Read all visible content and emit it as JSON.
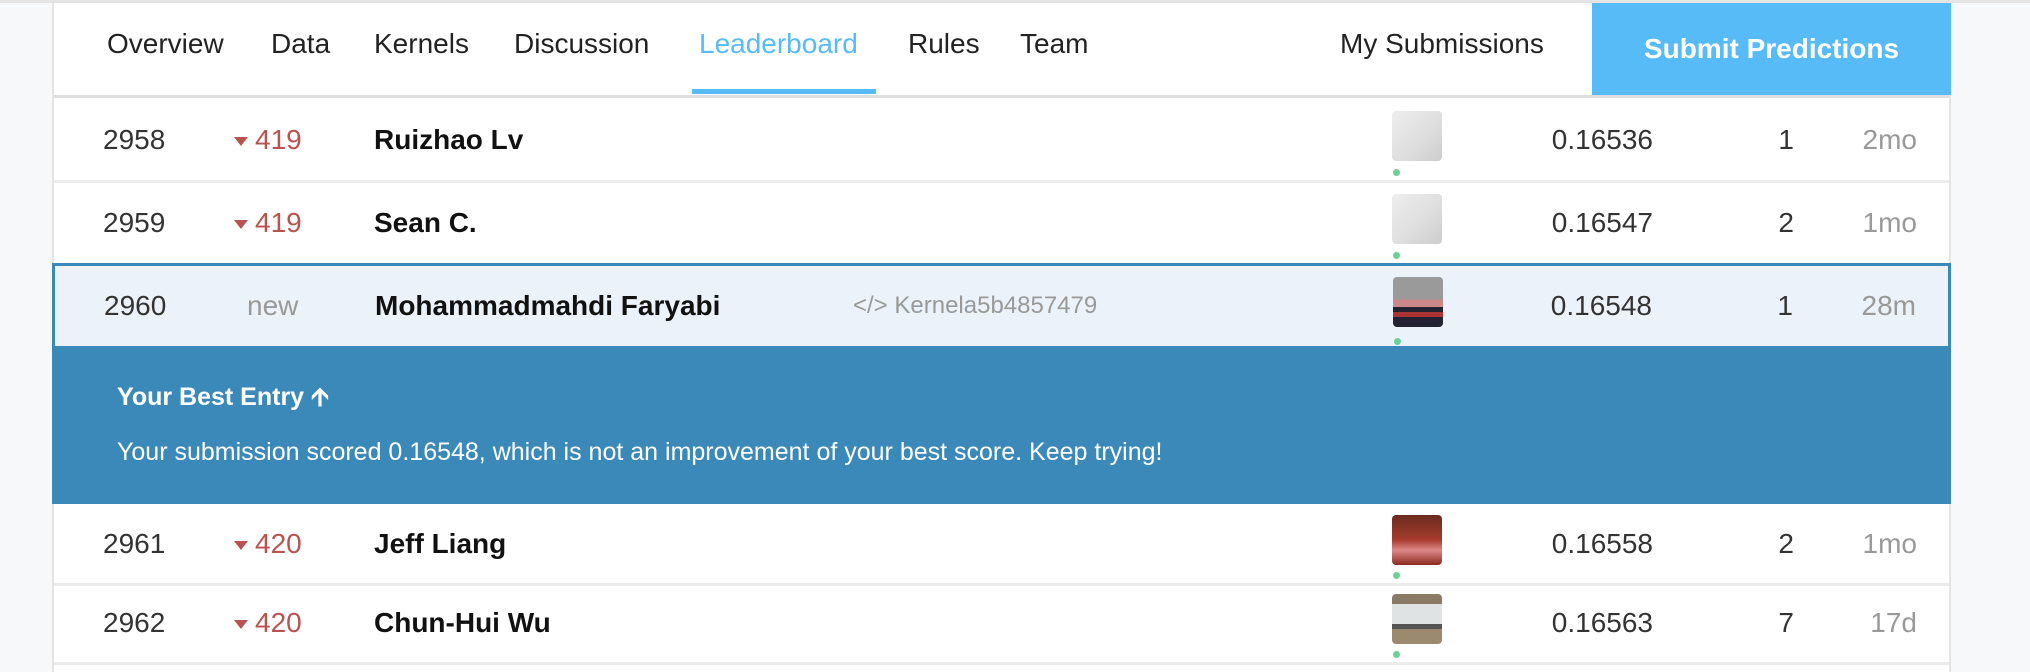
{
  "nav": {
    "tabs": [
      {
        "label": "Overview",
        "active": false
      },
      {
        "label": "Data",
        "active": false
      },
      {
        "label": "Kernels",
        "active": false
      },
      {
        "label": "Discussion",
        "active": false
      },
      {
        "label": "Leaderboard",
        "active": true
      },
      {
        "label": "Rules",
        "active": false
      },
      {
        "label": "Team",
        "active": false
      }
    ],
    "my_submissions": "My Submissions",
    "submit": "Submit Predictions"
  },
  "colors": {
    "accent": "#56bbf6",
    "highlight": "#3a89b9",
    "rank_down": "#b9534f",
    "online": "#6ccf97"
  },
  "rows": [
    {
      "rank": "2958",
      "change": "419",
      "change_dir": "down",
      "name": "Ruizhao Lv",
      "kernel": "",
      "score": "0.16536",
      "entries": "1",
      "last": "2mo",
      "avatar": "goose-avatar"
    },
    {
      "rank": "2959",
      "change": "419",
      "change_dir": "down",
      "name": "Sean C.",
      "kernel": "",
      "score": "0.16547",
      "entries": "2",
      "last": "1mo",
      "avatar": "goose-avatar"
    },
    {
      "rank": "2960",
      "change": "new",
      "change_dir": "new",
      "name": "Mohammadmahdi Faryabi",
      "kernel": "Kernela5b4857479",
      "kernel_icon": "code-icon",
      "score": "0.16548",
      "entries": "1",
      "last": "28m",
      "avatar": "photo-avatar"
    },
    {
      "rank": "2961",
      "change": "420",
      "change_dir": "down",
      "name": "Jeff Liang",
      "kernel": "",
      "score": "0.16558",
      "entries": "2",
      "last": "1mo",
      "avatar": "anime-avatar"
    },
    {
      "rank": "2962",
      "change": "420",
      "change_dir": "down",
      "name": "Chun-Hui Wu",
      "kernel": "",
      "score": "0.16563",
      "entries": "7",
      "last": "17d",
      "avatar": "office-avatar"
    }
  ],
  "banner": {
    "title": "Your Best Entry",
    "title_icon": "arrow-up-icon",
    "message": "Your submission scored 0.16548, which is not an improvement of your best score. Keep trying!"
  }
}
